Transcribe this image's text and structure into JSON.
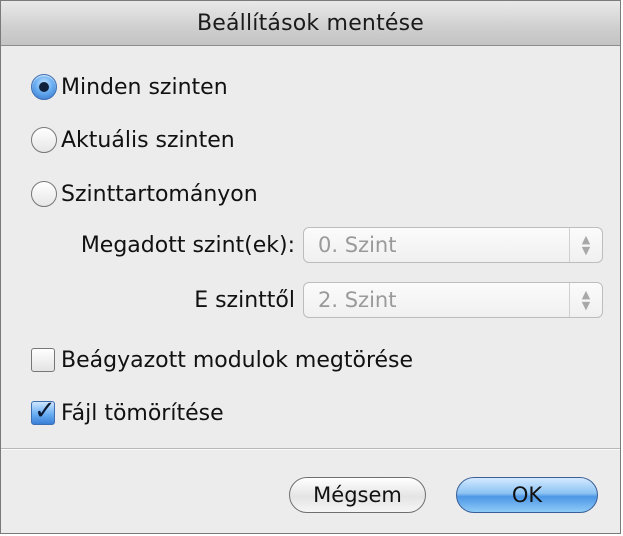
{
  "dialog": {
    "title": "Beállítások mentése"
  },
  "options": {
    "radios": [
      {
        "label": "Minden szinten",
        "selected": true
      },
      {
        "label": "Aktuális szinten",
        "selected": false
      },
      {
        "label": "Szinttartományon",
        "selected": false
      }
    ],
    "range": {
      "levels_label": "Megadott szint(ek):",
      "levels_value": "0. Szint",
      "from_label": "E szinttől",
      "from_value": "2. Szint"
    },
    "checkboxes": [
      {
        "label": "Beágyazott modulok megtörése",
        "checked": false
      },
      {
        "label": "Fájl tömörítése",
        "checked": true
      }
    ]
  },
  "buttons": {
    "cancel_label": "Mégsem",
    "ok_label": "OK"
  },
  "colors": {
    "accent": "#4d97e6",
    "window_bg": "#ececec"
  }
}
